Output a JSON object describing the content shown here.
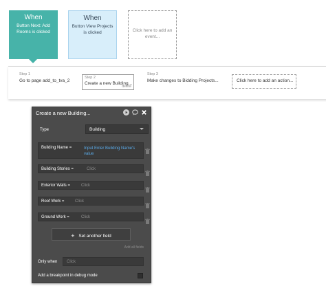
{
  "events": [
    {
      "when": "When",
      "desc": "Button Next: Add Rooms is clicked"
    },
    {
      "when": "When",
      "desc": "Button View Projects is clicked"
    },
    {
      "when": "",
      "desc": "Click here to add an event..."
    }
  ],
  "steps": [
    {
      "label": "Step 1",
      "text": "Go to page add_to_tva_2"
    },
    {
      "label": "Step 2",
      "text": "Create a new Building...",
      "delete": "delete"
    },
    {
      "label": "Step 3",
      "text": "Make changes to Bidding Projects..."
    },
    {
      "label": "",
      "text": "Click here to add an action..."
    }
  ],
  "panel": {
    "title": "Create a new Building...",
    "type_label": "Type",
    "type_value": "Building",
    "fields": [
      {
        "name": "Building Name =",
        "value": "Input Enter Building Name's value"
      },
      {
        "name": "Building Stories =",
        "value": "Click"
      },
      {
        "name": "Exterior Walls =",
        "value": "Click"
      },
      {
        "name": "Roof Work =",
        "value": "Click"
      },
      {
        "name": "Ground Work =",
        "value": "Click"
      }
    ],
    "set_another_field": "Set another field",
    "add_all_fields": "Add all fields",
    "only_when_label": "Only when",
    "only_when_placeholder": "Click",
    "breakpoint_label": "Add a breakpoint in debug mode"
  },
  "colors": {
    "accent": "#47b3a9",
    "event_selected_bg": "#d8eefa",
    "panel_bg": "#4b4b4b",
    "link_blue": "#5aa9e6"
  },
  "icons": {
    "panel": [
      "play-icon",
      "comment-icon",
      "close-icon"
    ],
    "field": "trash-icon"
  }
}
